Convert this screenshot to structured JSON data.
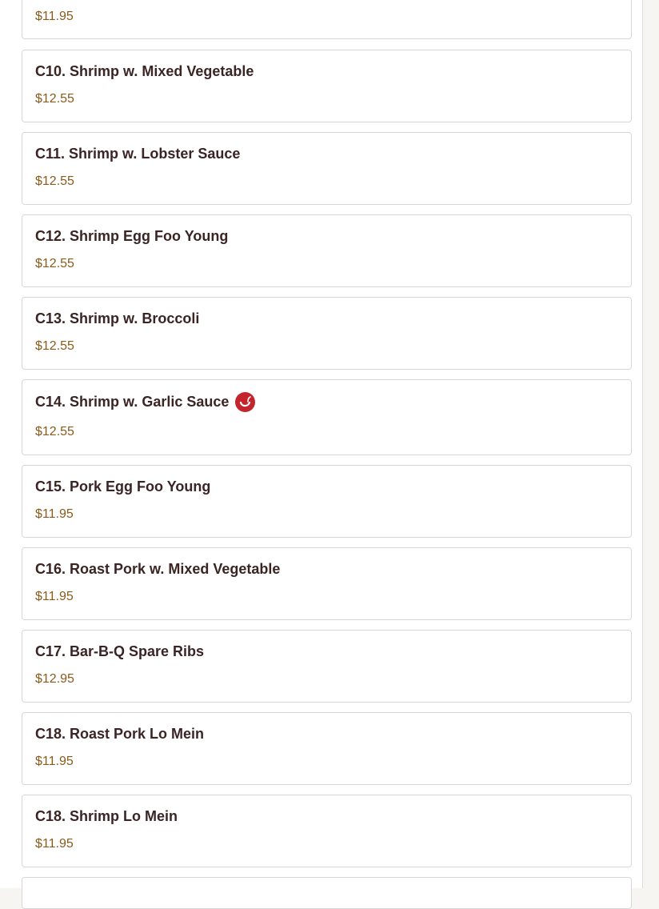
{
  "menu": {
    "items": [
      {
        "name": "",
        "price": "$11.95"
      },
      {
        "name": "C10. Shrimp w. Mixed Vegetable",
        "price": "$12.55"
      },
      {
        "name": "C11. Shrimp w. Lobster Sauce",
        "price": "$12.55"
      },
      {
        "name": "C12. Shrimp Egg Foo Young",
        "price": "$12.55"
      },
      {
        "name": "C13. Shrimp w. Broccoli",
        "price": "$12.55"
      },
      {
        "name": "C14. Shrimp w. Garlic Sauce",
        "price": "$12.55",
        "icon": "spicy-pepper-icon"
      },
      {
        "name": "C15. Pork Egg Foo Young",
        "price": "$11.95"
      },
      {
        "name": "C16. Roast Pork w. Mixed Vegetable",
        "price": "$11.95"
      },
      {
        "name": "C17. Bar-B-Q Spare Ribs",
        "price": "$12.95"
      },
      {
        "name": "C18. Roast Pork Lo Mein",
        "price": "$11.95"
      },
      {
        "name": "C18. Shrimp Lo Mein",
        "price": "$11.95"
      }
    ]
  },
  "colors": {
    "item_name": "#3a2424",
    "price": "#8a5a1b",
    "spicy_icon": "#c4242c",
    "card_border": "#d7d7d7"
  }
}
